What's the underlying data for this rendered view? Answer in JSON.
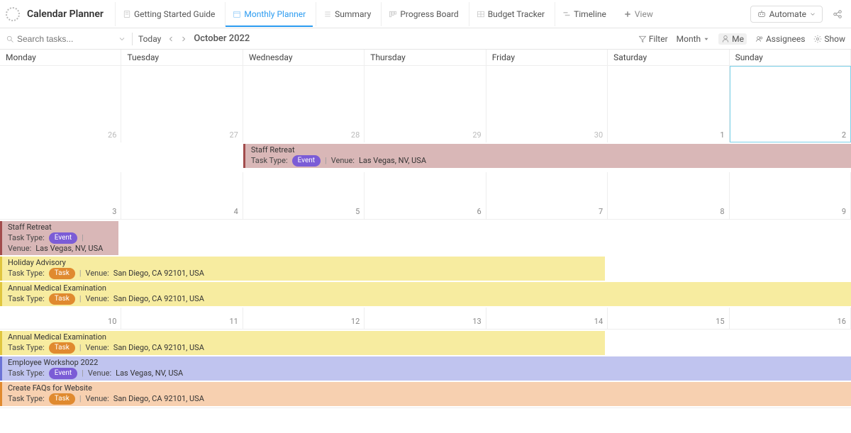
{
  "header": {
    "title": "Calendar Planner",
    "tabs": [
      {
        "label": "Getting Started Guide"
      },
      {
        "label": "Monthly Planner"
      },
      {
        "label": "Summary"
      },
      {
        "label": "Progress Board"
      },
      {
        "label": "Budget Tracker"
      },
      {
        "label": "Timeline"
      }
    ],
    "add_view": "View",
    "automate": "Automate"
  },
  "toolbar": {
    "search_placeholder": "Search tasks...",
    "today": "Today",
    "month_title": "October 2022",
    "filter": "Filter",
    "mode": "Month",
    "me": "Me",
    "assignees": "Assignees",
    "show": "Show"
  },
  "days": [
    "Monday",
    "Tuesday",
    "Wednesday",
    "Thursday",
    "Friday",
    "Saturday",
    "Sunday"
  ],
  "weeks": {
    "w1": [
      "26",
      "27",
      "28",
      "29",
      "30",
      "1",
      "2"
    ],
    "w2": [
      "3",
      "4",
      "5",
      "6",
      "7",
      "8",
      "9"
    ],
    "w3": [
      "10",
      "11",
      "12",
      "13",
      "14",
      "15",
      "16"
    ]
  },
  "labels": {
    "task_type": "Task Type:",
    "venue": "Venue:",
    "event_badge": "Event",
    "task_badge": "Task"
  },
  "events": {
    "e1": {
      "title": "Staff Retreat",
      "venue": "Las Vegas, NV, USA"
    },
    "e2": {
      "title": "Staff Retreat",
      "venue": "Las Vegas, NV, USA"
    },
    "e3": {
      "title": "Holiday Advisory",
      "venue": "San Diego, CA 92101, USA"
    },
    "e4": {
      "title": "Annual Medical Examination",
      "venue": "San Diego, CA 92101, USA"
    },
    "e5": {
      "title": "Annual Medical Examination",
      "venue": "San Diego, CA 92101, USA"
    },
    "e6": {
      "title": "Employee Workshop 2022",
      "venue": "Las Vegas, NV, USA"
    },
    "e7": {
      "title": "Create FAQs for Website",
      "venue": "San Diego, CA 92101, USA"
    }
  }
}
